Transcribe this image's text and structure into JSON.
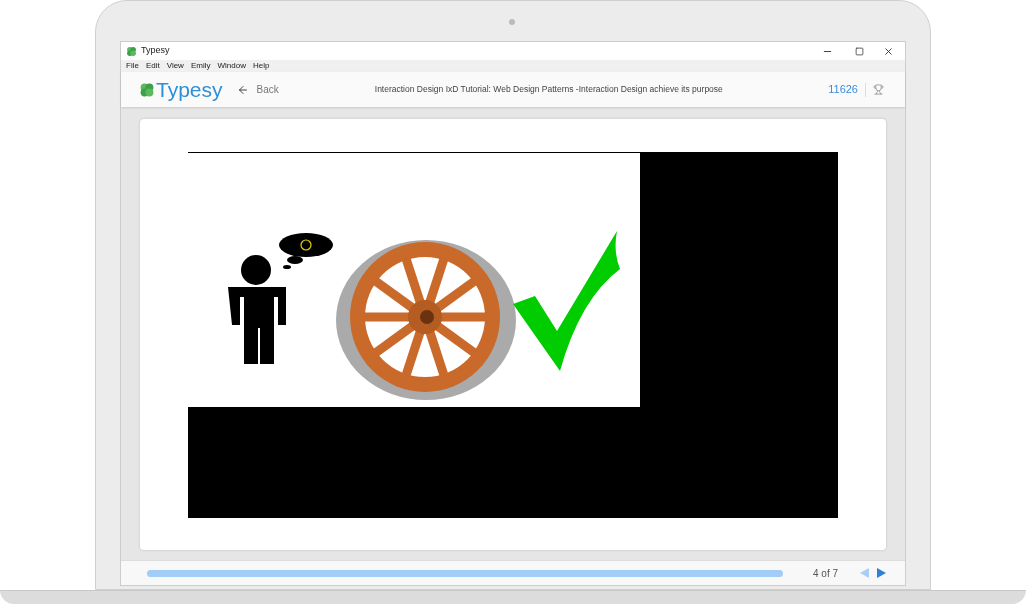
{
  "window": {
    "title": "Typesy"
  },
  "menu": [
    "File",
    "Edit",
    "View",
    "Emily",
    "Window",
    "Help"
  ],
  "header": {
    "logo": "Typesy",
    "back": "Back",
    "course_title": "Interaction Design IxD Tutorial: Web Design Patterns -Interaction Design achieve its purpose",
    "points": "11626"
  },
  "player": {
    "progress": {
      "level": 1
    },
    "page": "4 of 7",
    "prev": {
      "disabled": true
    },
    "next": {
      "disabled": false
    }
  }
}
